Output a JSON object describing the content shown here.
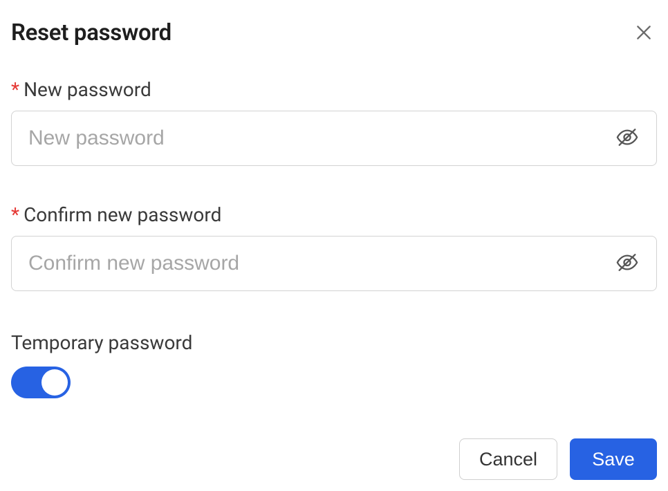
{
  "dialog": {
    "title": "Reset password"
  },
  "fields": {
    "new_password": {
      "label": "New password",
      "placeholder": "New password",
      "value": "",
      "required_mark": "*"
    },
    "confirm_password": {
      "label": "Confirm new password",
      "placeholder": "Confirm new password",
      "value": "",
      "required_mark": "*"
    },
    "temporary": {
      "label": "Temporary password",
      "on": true
    }
  },
  "actions": {
    "cancel": "Cancel",
    "save": "Save"
  }
}
